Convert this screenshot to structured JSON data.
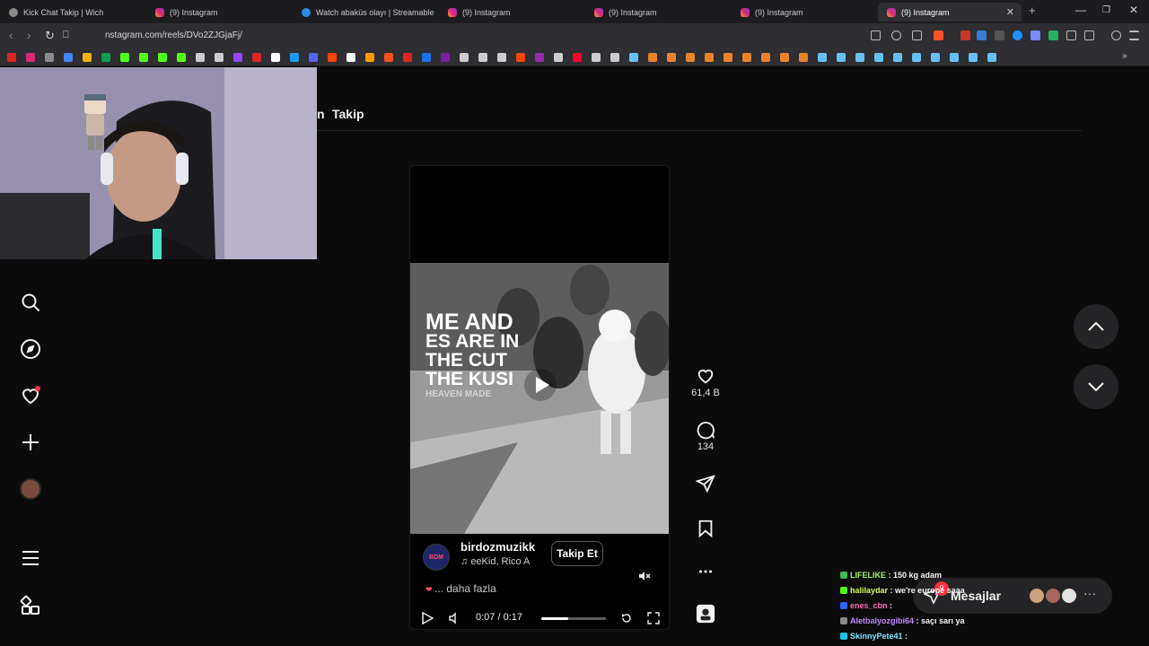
{
  "browser": {
    "tabs": [
      {
        "title": "Kick Chat Takip | Wich",
        "active": false
      },
      {
        "title": "(9) Instagram",
        "active": false
      },
      {
        "title": "Watch abaküs olayı | Streamable",
        "active": false
      },
      {
        "title": "(9) Instagram",
        "active": false
      },
      {
        "title": "(9) Instagram",
        "active": false
      },
      {
        "title": "(9) Instagram",
        "active": false
      },
      {
        "title": "(9) Instagram",
        "active": true
      }
    ],
    "url": "nstagram.com/reels/DVo2ZJGjaFj/"
  },
  "page": {
    "header_fragment": "n",
    "header_tab": "Takip"
  },
  "reel": {
    "overlay_text": [
      "ME AND",
      "ES ARE IN",
      "THE CUT",
      "THE KUSI",
      "HEAVEN MADE"
    ],
    "username": "birdozmuzikk",
    "avatar_text": "BDM",
    "music": "eeKid, Rico A",
    "follow_label": "Takip Et",
    "caption": "... daha fazla",
    "time": "0:07 / 0:17",
    "progress_fraction": 0.41
  },
  "actions": {
    "likes": "61,4 B",
    "comments": "134"
  },
  "messages": {
    "label": "Mesajlar",
    "badge": "9"
  },
  "chat": [
    {
      "user": "LIFELIKE",
      "message": "150 kg adam",
      "color": "#a7f36a"
    },
    {
      "user": "halilaydar",
      "message": "we're europe saaa",
      "color": "#d7ff5c"
    },
    {
      "user": "enes_cbn",
      "message": "",
      "color": "#ff6fb1"
    },
    {
      "user": "Aletbalyozgibi64",
      "message": "saçı sarı ya",
      "color": "#c08bff"
    },
    {
      "user": "SkinnyPete41",
      "message": "",
      "color": "#7fe8ff"
    }
  ],
  "colors": {
    "background": "#0b0b0c",
    "notification": "#ff3040",
    "tab_active": "#2e2e33"
  }
}
